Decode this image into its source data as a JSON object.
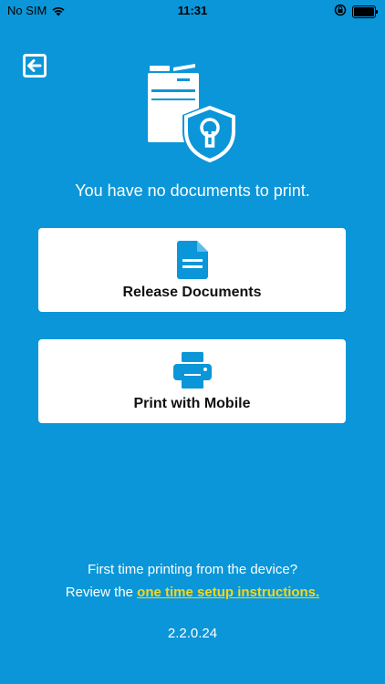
{
  "status_bar": {
    "carrier": "No SIM",
    "time": "11:31"
  },
  "main": {
    "empty_message": "You have no documents to print."
  },
  "actions": [
    {
      "label": "Release Documents",
      "icon": "document-icon"
    },
    {
      "label": "Print with Mobile",
      "icon": "printer-icon"
    }
  ],
  "footer": {
    "question": "First time printing from the device?",
    "review_prefix": "Review the ",
    "setup_link": "one time setup instructions.",
    "version": "2.2.0.24"
  },
  "colors": {
    "background": "#0a96d8",
    "card": "#ffffff",
    "link": "#f8d61a",
    "icon": "#0a96d8"
  }
}
